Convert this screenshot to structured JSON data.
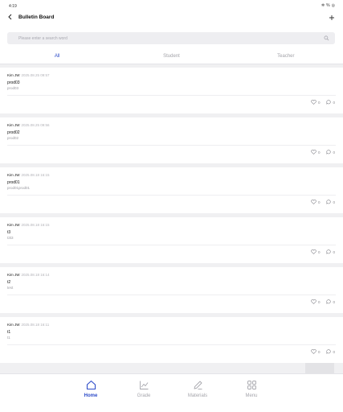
{
  "status": {
    "time": "4:19",
    "bluetooth": "✲",
    "battery": "%",
    "wifi": "◎"
  },
  "app_bar": {
    "title": "Bulletin Board",
    "back_icon": "back-arrow-icon",
    "add_icon": "plus-icon"
  },
  "search": {
    "placeholder": "Please enter a search word",
    "value": "",
    "icon": "search-icon"
  },
  "tabs": [
    {
      "label": "All",
      "active": true
    },
    {
      "label": "Student",
      "active": false
    },
    {
      "label": "Teacher",
      "active": false
    }
  ],
  "posts": [
    {
      "author": "Kim JW",
      "date": "2025.08.25 09:57",
      "title": "prod03",
      "body": "prod03",
      "likes": "0",
      "comments": "0"
    },
    {
      "author": "Kim JW",
      "date": "2025.08.25 09:56",
      "title": "prod02",
      "body": "prod02",
      "likes": "0",
      "comments": "0"
    },
    {
      "author": "Kim JW",
      "date": "2025.08.18 16:15",
      "title": "prod01",
      "body": "prod01prod01",
      "likes": "0",
      "comments": "0"
    },
    {
      "author": "Kim JW",
      "date": "2025.08.18 16:15",
      "title": "t3",
      "body": "t3t3",
      "likes": "0",
      "comments": "0"
    },
    {
      "author": "Kim JW",
      "date": "2025.08.18 16:14",
      "title": "t2",
      "body": "test",
      "likes": "0",
      "comments": "0"
    },
    {
      "author": "Kim JW",
      "date": "2025.08.18 16:11",
      "title": "t1",
      "body": "t1",
      "likes": "0",
      "comments": "0"
    }
  ],
  "bottom_nav": [
    {
      "label": "Home",
      "icon": "home-icon",
      "active": true
    },
    {
      "label": "Grade",
      "icon": "chart-icon",
      "active": false
    },
    {
      "label": "Materials",
      "icon": "pencil-icon",
      "active": false
    },
    {
      "label": "Menu",
      "icon": "grid-icon",
      "active": false
    }
  ],
  "colors": {
    "accent": "#2e4cc9",
    "inactive": "#a6a6ac",
    "background": "#f0f0f2"
  }
}
